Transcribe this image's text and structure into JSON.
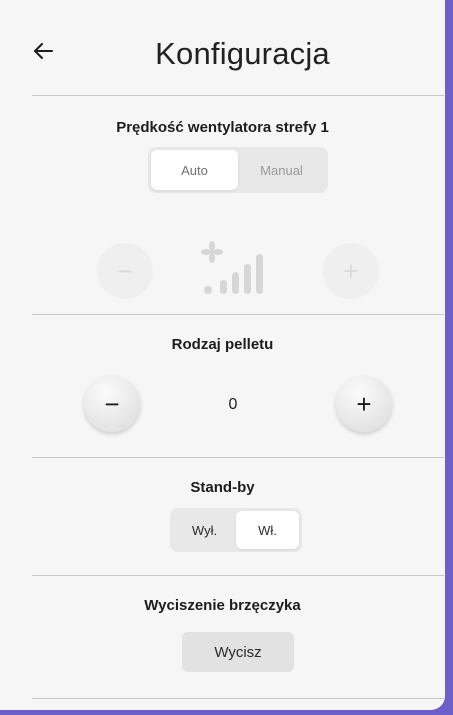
{
  "header": {
    "title": "Konfiguracja"
  },
  "fan_speed": {
    "title": "Prędkość wentylatora strefy 1",
    "mode_options": [
      "Auto",
      "Manual"
    ],
    "selected_mode": "Auto",
    "decrease_label": "−",
    "increase_label": "+",
    "level_icon": "fan-level-icon"
  },
  "pellet": {
    "title": "Rodzaj pelletu",
    "value": "0",
    "decrease_label": "−",
    "increase_label": "+"
  },
  "standby": {
    "title": "Stand-by",
    "options": [
      "Wył.",
      "Wł."
    ],
    "selected": "Wł."
  },
  "buzzer": {
    "title": "Wyciszenie brzęczyka",
    "button_label": "Wycisz"
  },
  "colors": {
    "background": "#f6f6f6",
    "frame_accent": "#6d5fc9",
    "divider": "#c8c8c8",
    "button_gray": "#e2e2e2"
  }
}
